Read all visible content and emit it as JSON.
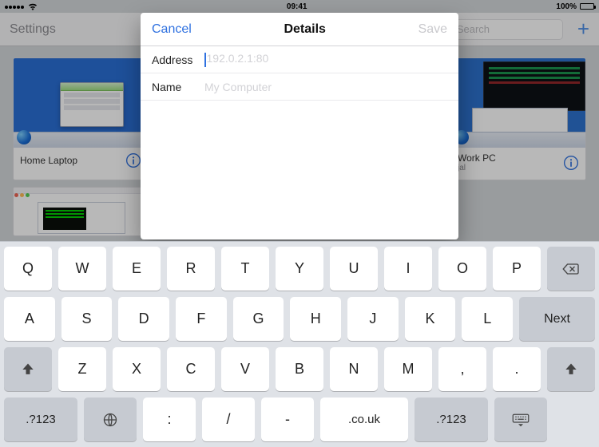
{
  "statusbar": {
    "time": "09:41",
    "battery_pct": "100%"
  },
  "nav": {
    "title": "Settings",
    "search_placeholder": "Search"
  },
  "cards": [
    {
      "name": "Home Laptop",
      "sub": ""
    },
    {
      "name": "Work PC",
      "sub": "jal"
    }
  ],
  "modal": {
    "cancel": "Cancel",
    "title": "Details",
    "save": "Save",
    "rows": {
      "address_label": "Address",
      "address_placeholder": "192.0.2.1:80",
      "name_label": "Name",
      "name_placeholder": "My Computer"
    }
  },
  "keyboard": {
    "row1": [
      "Q",
      "W",
      "E",
      "R",
      "T",
      "Y",
      "U",
      "I",
      "O",
      "P"
    ],
    "row2": [
      "A",
      "S",
      "D",
      "F",
      "G",
      "H",
      "J",
      "K",
      "L"
    ],
    "next": "Next",
    "row3": [
      "Z",
      "X",
      "C",
      "V",
      "B",
      "N",
      "M",
      ",",
      "."
    ],
    "row4": {
      "sym": ".?123",
      "colon": ":",
      "slash": "/",
      "dash": "-",
      "co": ".co.uk",
      "sym2": ".?123"
    }
  }
}
